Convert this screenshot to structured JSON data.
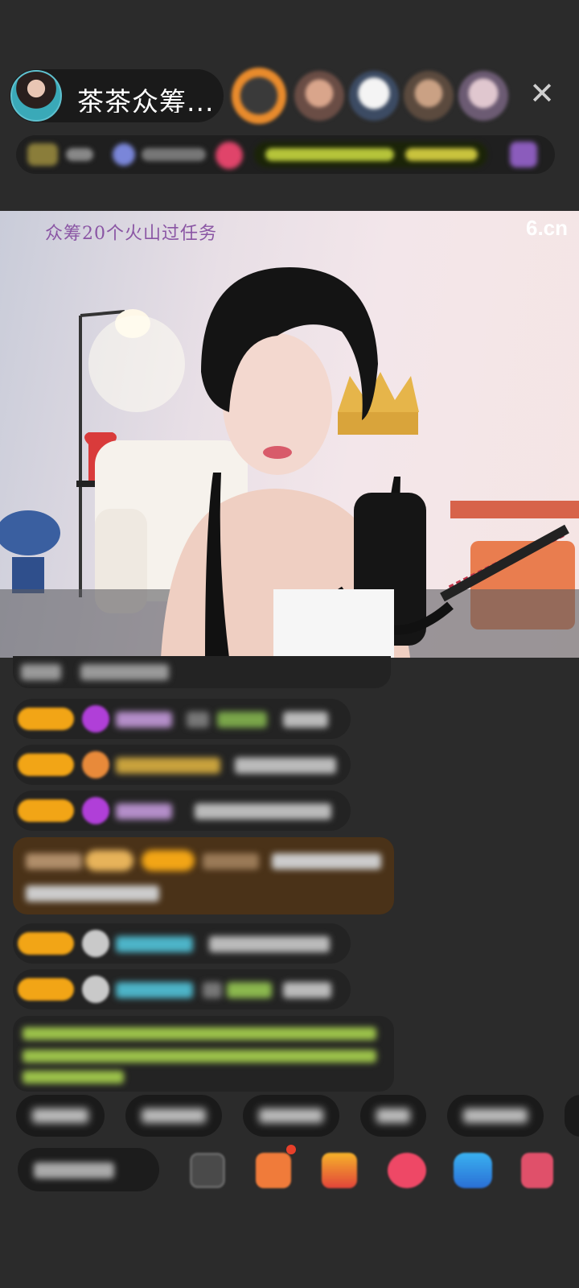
{
  "header": {
    "host_name": "茶茶众筹...",
    "close_icon": "close-icon"
  },
  "video": {
    "caption": "众筹20个火山过任务",
    "logo": "6.cn"
  },
  "colors": {
    "background": "#2b2b2b",
    "badge": "#f2a516",
    "caption": "#8a55a4",
    "green_text": "#9cc24a"
  },
  "chat": {
    "blurred": true
  },
  "icons": [
    "close-icon",
    "emoji-icon",
    "gift-icon",
    "box-icon",
    "heart-icon",
    "game-icon",
    "grid-icon"
  ]
}
